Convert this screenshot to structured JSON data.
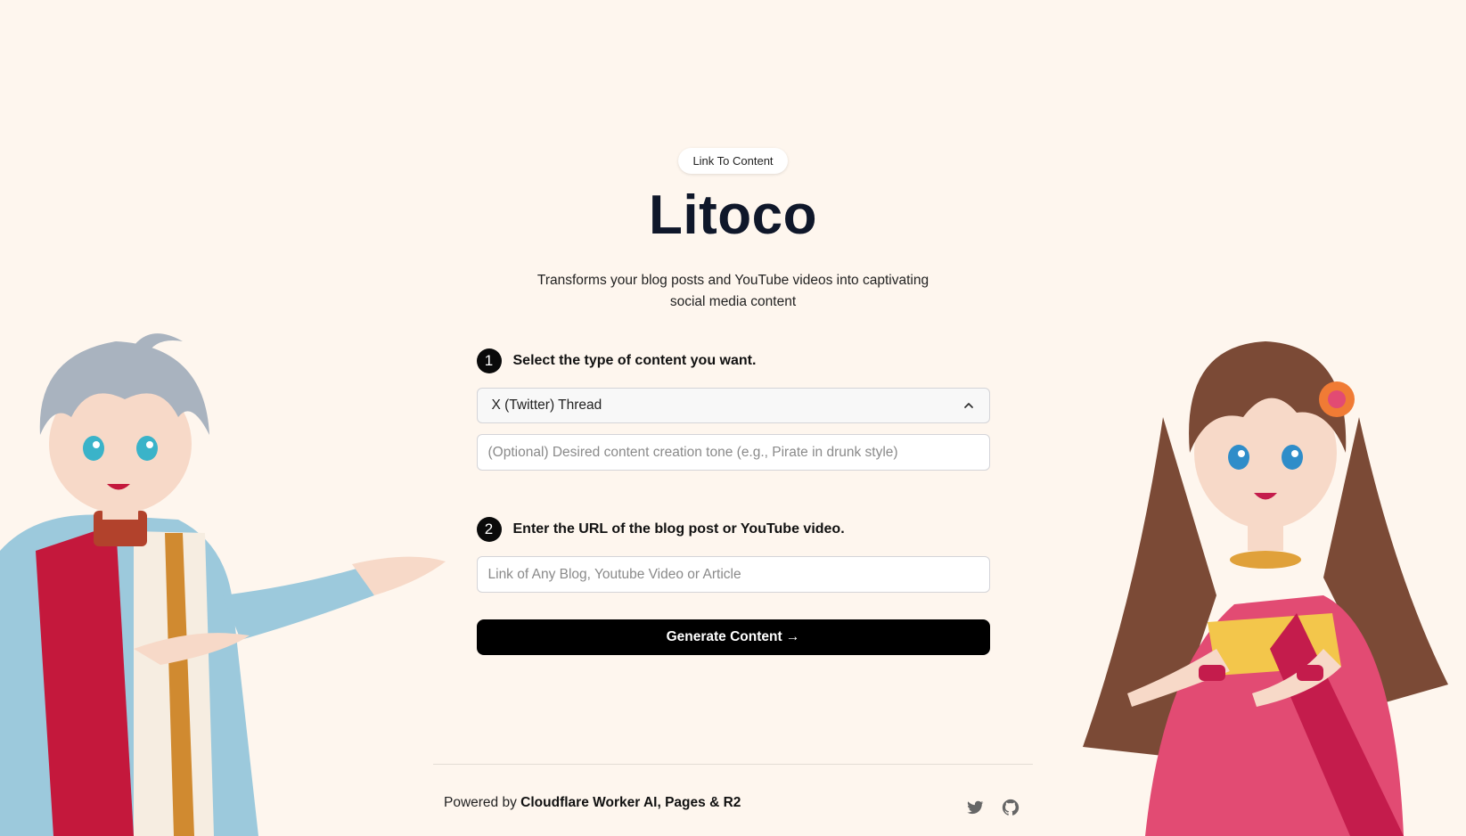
{
  "badge": "Link To Content",
  "title": "Litoco",
  "subtitle": "Transforms your blog posts and YouTube videos into captivating social media content",
  "steps": [
    {
      "number": "1",
      "label": "Select the type of content you want."
    },
    {
      "number": "2",
      "label": "Enter the URL of the blog post or YouTube video."
    }
  ],
  "content_type": {
    "selected": "X (Twitter) Thread"
  },
  "tone_input": {
    "value": "",
    "placeholder": "(Optional) Desired content creation tone (e.g., Pirate in drunk style)"
  },
  "url_input": {
    "value": "",
    "placeholder": "Link of Any Blog, Youtube Video or Article"
  },
  "generate_button": "Generate Content →",
  "footer": {
    "prefix": "Powered by",
    "brand": "Cloudflare Worker AI, Pages & R2"
  },
  "icons": [
    "twitter-icon",
    "github-icon",
    "chevron-up-icon"
  ],
  "colors": {
    "background": "#fef6ee",
    "button": "#000000",
    "title": "#0f172a"
  }
}
